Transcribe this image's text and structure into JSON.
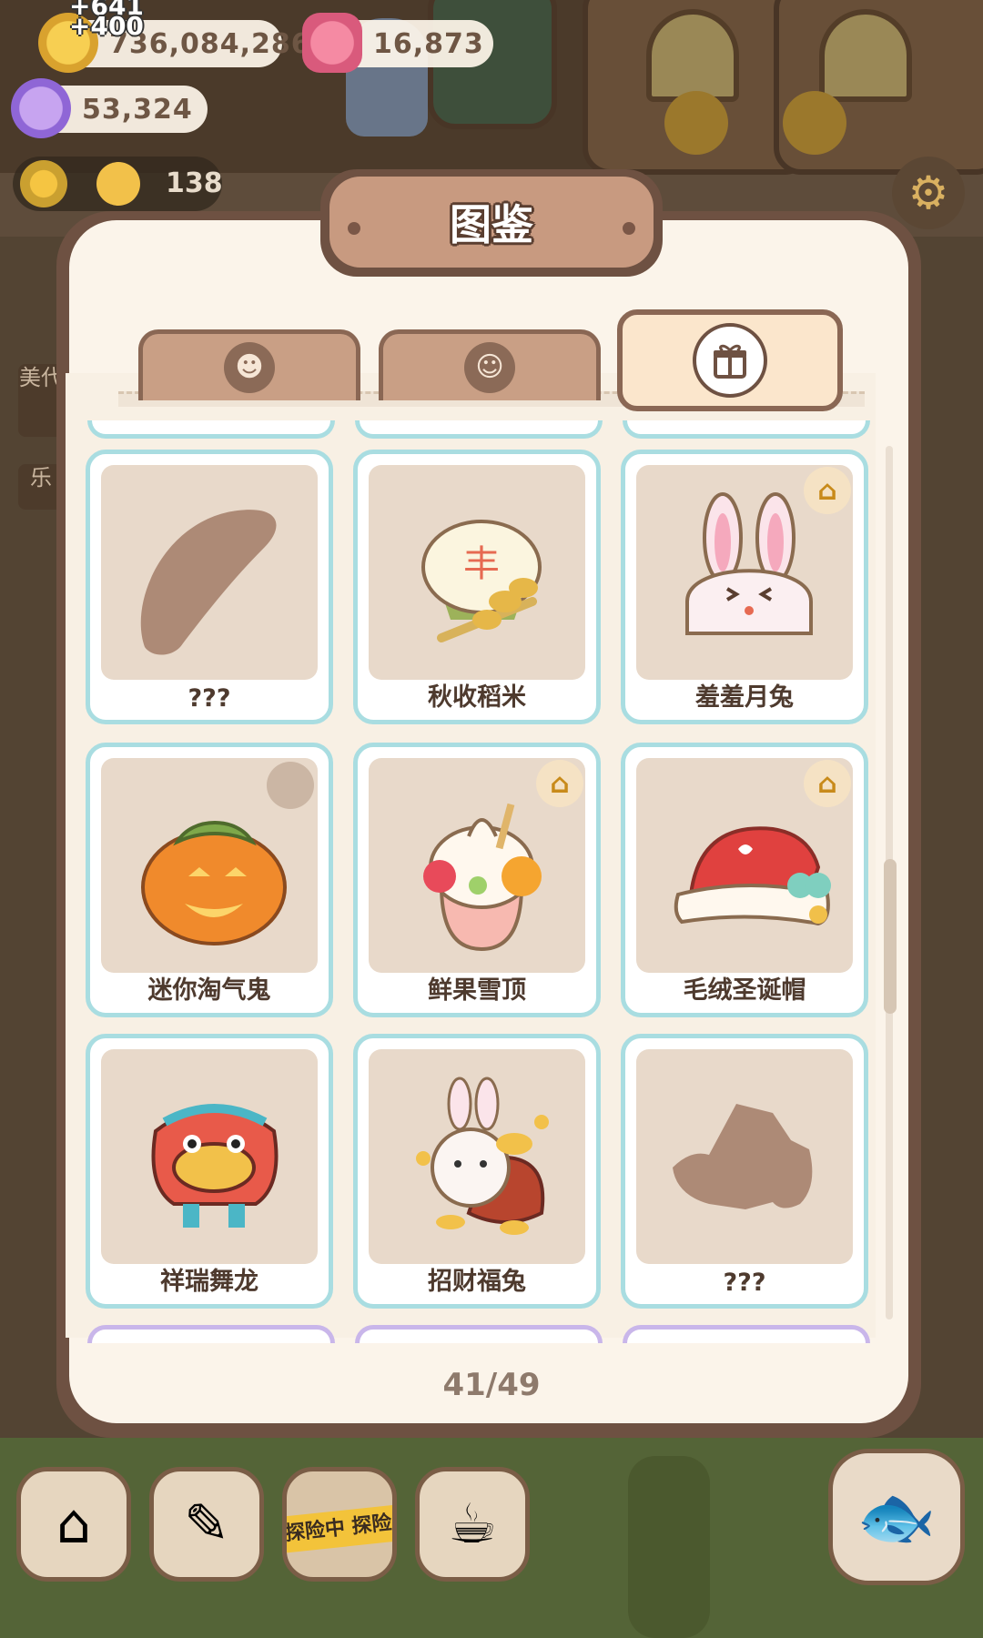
{
  "currencies": {
    "gold": "736,084,286",
    "gems": "16,873",
    "crystals": "53,324",
    "gold_gain_top": "+641",
    "gold_gain": "+400"
  },
  "level_bar": {
    "value": "138"
  },
  "side_tabs": [
    "美代",
    "乐"
  ],
  "panel": {
    "title": "图鉴",
    "tabs": [
      {
        "icon": "face-icon",
        "active": false
      },
      {
        "icon": "chef-icon",
        "active": false
      },
      {
        "icon": "gift-box-icon",
        "active": true
      }
    ],
    "items": [
      {
        "label": "???",
        "locked": true,
        "hanger": false
      },
      {
        "label": "秋收稻米",
        "locked": false,
        "hanger": false
      },
      {
        "label": "羞羞月兔",
        "locked": false,
        "hanger": true
      },
      {
        "label": "迷你淘气鬼",
        "locked": false,
        "hanger": false
      },
      {
        "label": "鲜果雪顶",
        "locked": false,
        "hanger": true
      },
      {
        "label": "毛绒圣诞帽",
        "locked": false,
        "hanger": true
      },
      {
        "label": "祥瑞舞龙",
        "locked": false,
        "hanger": false
      },
      {
        "label": "招财福兔",
        "locked": false,
        "hanger": false
      },
      {
        "label": "???",
        "locked": true,
        "hanger": false
      }
    ],
    "counter": "41/49"
  },
  "bottom_bar": {
    "explore_tape": "探险中 探险"
  },
  "colors": {
    "panel_border": "#6e5142",
    "card_border": "#a9dde1",
    "card_bg": "#e8d9ca",
    "title_plate": "#c89a80"
  }
}
